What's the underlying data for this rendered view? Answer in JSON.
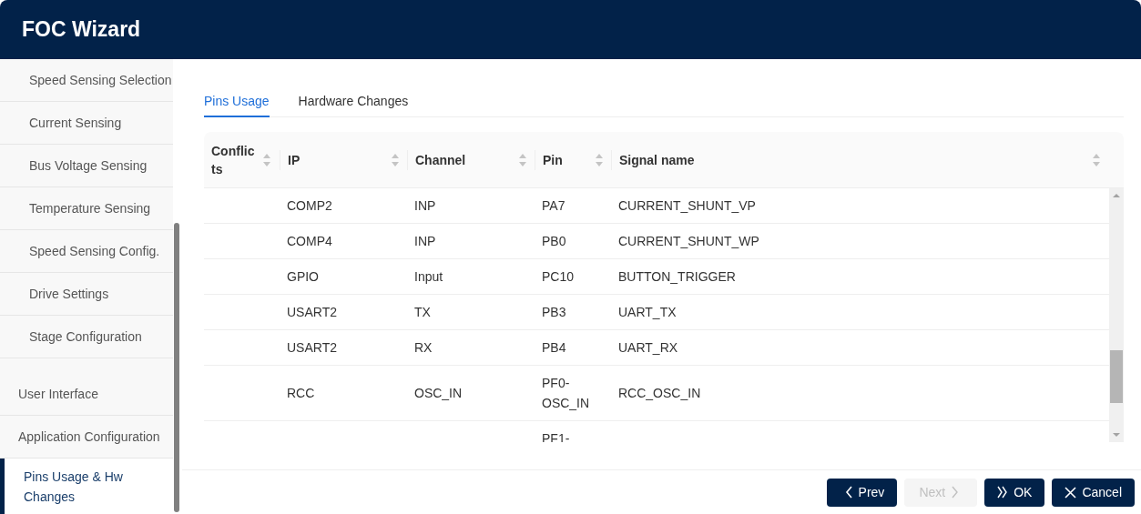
{
  "window": {
    "title": "FOC Wizard"
  },
  "sidebar": {
    "items": [
      {
        "label": "Speed Sensing Selection",
        "kind": "sub",
        "selected": false
      },
      {
        "label": "Current Sensing",
        "kind": "sub",
        "selected": false
      },
      {
        "label": "Bus Voltage Sensing",
        "kind": "sub",
        "selected": false
      },
      {
        "label": "Temperature Sensing",
        "kind": "sub",
        "selected": false
      },
      {
        "label": "Speed Sensing Config.",
        "kind": "sub",
        "selected": false
      },
      {
        "label": "Drive Settings",
        "kind": "sub",
        "selected": false
      },
      {
        "label": "Stage Configuration",
        "kind": "sub",
        "selected": false
      },
      {
        "label": "User Interface",
        "kind": "top",
        "selected": false
      },
      {
        "label": "Application Configuration",
        "kind": "top",
        "selected": false
      },
      {
        "label": "Pins Usage & Hw Changes",
        "kind": "top",
        "selected": true
      }
    ]
  },
  "tabs": [
    {
      "label": "Pins Usage",
      "selected": true
    },
    {
      "label": "Hardware Changes",
      "selected": false
    }
  ],
  "table": {
    "columns": [
      "Conflicts",
      "IP",
      "Channel",
      "Pin",
      "Signal name"
    ],
    "rows": [
      {
        "ip": "COMP2",
        "channel": "INP",
        "pin": "PA7",
        "signal": "CURRENT_SHUNT_VP"
      },
      {
        "ip": "COMP4",
        "channel": "INP",
        "pin": "PB0",
        "signal": "CURRENT_SHUNT_WP"
      },
      {
        "ip": "GPIO",
        "channel": "Input",
        "pin": "PC10",
        "signal": "BUTTON_TRIGGER"
      },
      {
        "ip": "USART2",
        "channel": "TX",
        "pin": "PB3",
        "signal": "UART_TX"
      },
      {
        "ip": "USART2",
        "channel": "RX",
        "pin": "PB4",
        "signal": "UART_RX"
      },
      {
        "ip": "RCC",
        "channel": "OSC_IN",
        "pin": "PF0-OSC_IN",
        "signal": "RCC_OSC_IN"
      },
      {
        "pin": "PF1-"
      }
    ]
  },
  "buttons": [
    {
      "label": "Prev",
      "kind": "prev",
      "disabled": false
    },
    {
      "label": "Next",
      "kind": "next",
      "disabled": true
    },
    {
      "label": "OK",
      "kind": "ok",
      "disabled": false
    },
    {
      "label": "Cancel",
      "kind": "cancel",
      "disabled": false
    }
  ]
}
